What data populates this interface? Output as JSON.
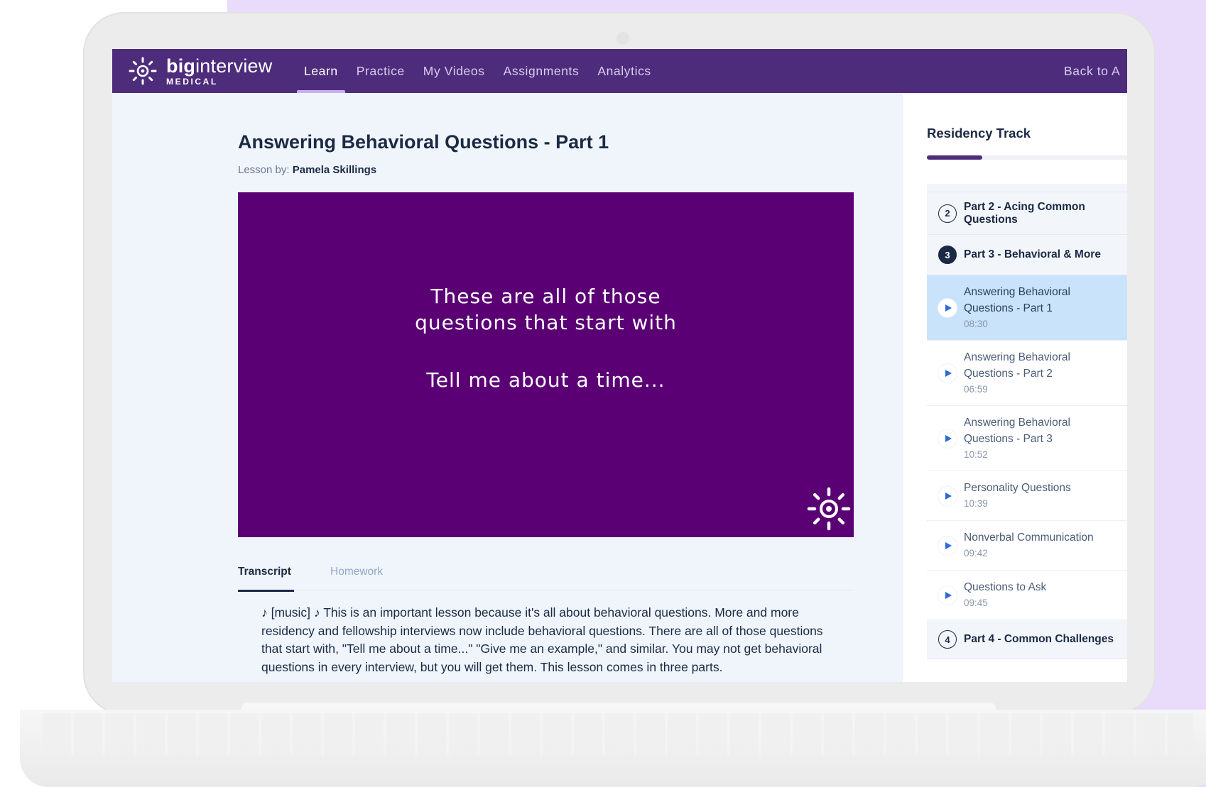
{
  "brand": {
    "name_bold": "big",
    "name_light": "interview",
    "sub": "MEDICAL"
  },
  "nav": {
    "items": [
      "Learn",
      "Practice",
      "My Videos",
      "Assignments",
      "Analytics"
    ],
    "active": "Learn",
    "back_link": "Back to A"
  },
  "lesson": {
    "title": "Answering Behavioral Questions - Part 1",
    "by_label": "Lesson by:",
    "author": "Pamela Skillings",
    "video_caption_1": "These are all of those",
    "video_caption_2": "questions that start with",
    "video_caption_3": "Tell me about a time...",
    "video_bg": "#5a0074"
  },
  "tabs": {
    "transcript": "Transcript",
    "homework": "Homework"
  },
  "transcript_text": "♪ [music] ♪ This is an important lesson because it's all about behavioral questions. More and more residency and fellowship interviews now include behavioral questions. There are all of those questions that start with, \"Tell me about a time...\" \"Give me an example,\" and similar. You may not get behavioral questions in every interview, but you will get them. This lesson comes in three parts.",
  "sidebar": {
    "title": "Residency Track",
    "progress_fraction": 0.26,
    "sections": [
      {
        "number": "2",
        "label_1": "Part 2 - Acing Common",
        "label_2": "Questions"
      },
      {
        "number": "3",
        "label": "Part 3 - Behavioral & More"
      },
      {
        "number": "4",
        "label": "Part 4 - Common Challenges"
      }
    ],
    "lessons": [
      {
        "name_1": "Answering Behavioral",
        "name_2": "Questions - Part 1",
        "duration": "08:30",
        "active": true
      },
      {
        "name_1": "Answering Behavioral",
        "name_2": "Questions - Part 2",
        "duration": "06:59"
      },
      {
        "name_1": "Answering Behavioral",
        "name_2": "Questions - Part 3",
        "duration": "10:52"
      },
      {
        "name": "Personality Questions",
        "duration": "10:39"
      },
      {
        "name": "Nonverbal Communication",
        "duration": "09:42"
      },
      {
        "name": "Questions to Ask",
        "duration": "09:45"
      }
    ]
  },
  "colors": {
    "nav_bg": "#4e2c7c",
    "accent": "#2b6bd6",
    "active_lesson_bg": "#c9e3fb",
    "background": "#e9dcfb"
  }
}
